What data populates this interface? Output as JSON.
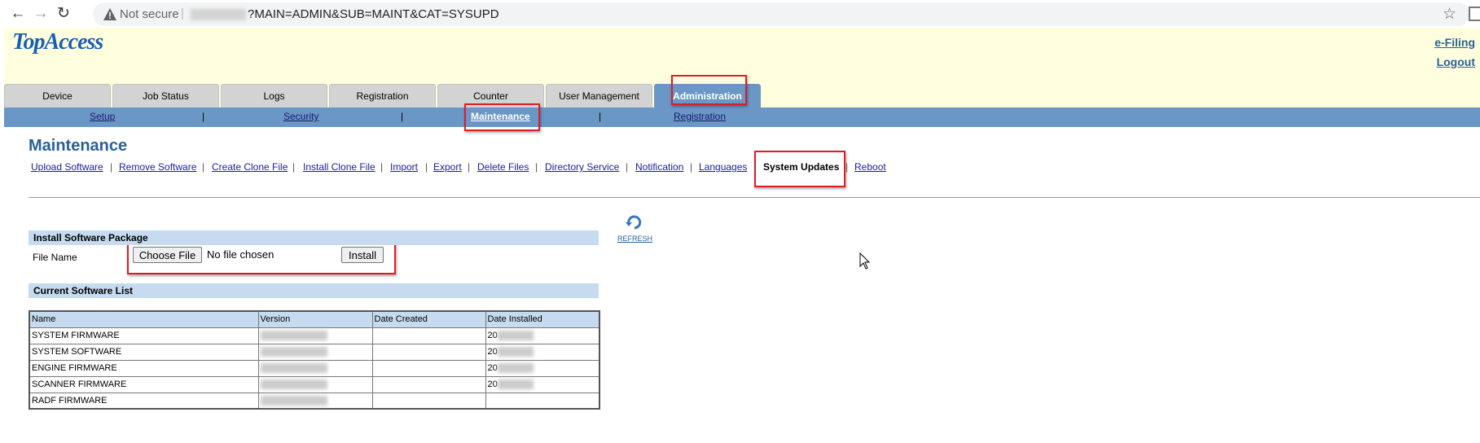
{
  "browser": {
    "back_icon": "←",
    "forward_icon": "→",
    "reload_icon": "↻",
    "security_label": "Not secure",
    "url_path": "?MAIN=ADMIN&SUB=MAINT&CAT=SYSUPD",
    "bookmark_icon": "☆"
  },
  "header": {
    "logo": "TopAccess",
    "efiling_link": "e-Filing",
    "logout_link": "Logout"
  },
  "tabs": [
    {
      "label": "Device"
    },
    {
      "label": "Job Status"
    },
    {
      "label": "Logs"
    },
    {
      "label": "Registration"
    },
    {
      "label": "Counter"
    },
    {
      "label": "User Management"
    },
    {
      "label": "Administration"
    }
  ],
  "subnav": {
    "items": [
      {
        "label": "Setup"
      },
      {
        "label": "Security"
      },
      {
        "label": "Maintenance"
      },
      {
        "label": "Registration"
      }
    ],
    "separator": "|"
  },
  "page": {
    "title": "Maintenance",
    "links": [
      {
        "label": "Upload Software"
      },
      {
        "label": "Remove Software"
      },
      {
        "label": "Create Clone File"
      },
      {
        "label": "Install Clone File"
      },
      {
        "label": "Import"
      },
      {
        "label": "Export"
      },
      {
        "label": "Delete Files"
      },
      {
        "label": "Directory Service"
      },
      {
        "label": "Notification"
      },
      {
        "label": "Languages"
      },
      {
        "label": "System Updates"
      },
      {
        "label": "Reboot"
      }
    ],
    "refresh_label": "REFRESH"
  },
  "install": {
    "section_title": "Install Software Package",
    "file_label": "File Name",
    "choose_button": "Choose File",
    "no_file_text": "No file chosen",
    "install_button": "Install"
  },
  "software_list": {
    "section_title": "Current Software List",
    "columns": [
      "Name",
      "Version",
      "Date Created",
      "Date Installed"
    ],
    "rows": [
      {
        "name": "SYSTEM FIRMWARE",
        "installed_prefix": "20"
      },
      {
        "name": "SYSTEM SOFTWARE",
        "installed_prefix": "20"
      },
      {
        "name": "ENGINE FIRMWARE",
        "installed_prefix": "20"
      },
      {
        "name": "SCANNER FIRMWARE",
        "installed_prefix": "20"
      },
      {
        "name": "RADF FIRMWARE",
        "installed_prefix": ""
      }
    ]
  },
  "colors": {
    "tab_active": "#6b97c6",
    "banner": "#ffffe0",
    "annotation": "#e01b24",
    "title": "#2a6099"
  }
}
